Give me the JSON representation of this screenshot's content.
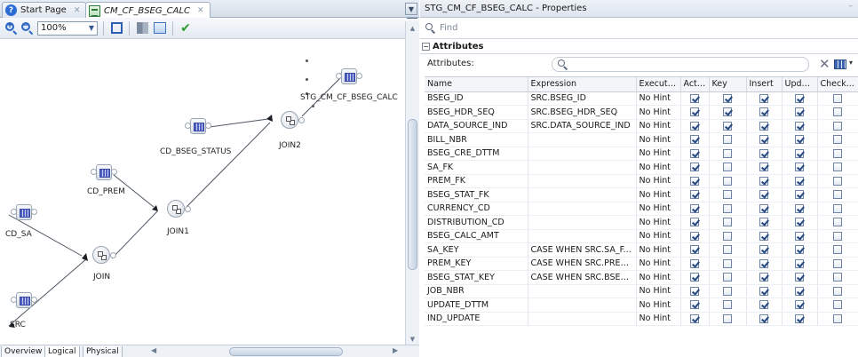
{
  "editor": {
    "tabs": [
      {
        "label": "Start Page",
        "active": false
      },
      {
        "label": "CM_CF_BSEG_CALC",
        "active": true
      }
    ],
    "zoom_value": "100%",
    "nodes": {
      "target": "STG_CM_CF_BSEG_CALC",
      "cd_bseg_status": "CD_BSEG_STATUS",
      "join2": "JOIN2",
      "cd_prem": "CD_PREM",
      "join1": "JOIN1",
      "cd_sa": "CD_SA",
      "join": "JOIN",
      "src": "SRC"
    },
    "bottom_tabs": [
      "Overview",
      "Logical",
      "Physical"
    ]
  },
  "properties": {
    "title": "STG_CM_CF_BSEG_CALC - Properties",
    "find_placeholder": "Find",
    "section_title": "Attributes",
    "attributes_label": "Attributes:",
    "columns": [
      "Name",
      "Expression",
      "Execute ...",
      "Active",
      "Key",
      "Insert",
      "Update",
      "Check..."
    ],
    "rows": [
      {
        "name": "BSEG_ID",
        "expression": "SRC.BSEG_ID",
        "execute": "No Hint",
        "active": true,
        "key": true,
        "insert": true,
        "update": true,
        "check": false
      },
      {
        "name": "BSEG_HDR_SEQ",
        "expression": "SRC.BSEG_HDR_SEQ",
        "execute": "No Hint",
        "active": true,
        "key": true,
        "insert": true,
        "update": true,
        "check": false
      },
      {
        "name": "DATA_SOURCE_IND",
        "expression": "SRC.DATA_SOURCE_IND",
        "execute": "No Hint",
        "active": true,
        "key": true,
        "insert": true,
        "update": true,
        "check": false
      },
      {
        "name": "BILL_NBR",
        "expression": "",
        "execute": "No Hint",
        "active": true,
        "key": false,
        "insert": true,
        "update": true,
        "check": false
      },
      {
        "name": "BSEG_CRE_DTTM",
        "expression": "",
        "execute": "No Hint",
        "active": true,
        "key": false,
        "insert": true,
        "update": true,
        "check": false
      },
      {
        "name": "SA_FK",
        "expression": "",
        "execute": "No Hint",
        "active": true,
        "key": false,
        "insert": true,
        "update": true,
        "check": false
      },
      {
        "name": "PREM_FK",
        "expression": "",
        "execute": "No Hint",
        "active": true,
        "key": false,
        "insert": true,
        "update": true,
        "check": false
      },
      {
        "name": "BSEG_STAT_FK",
        "expression": "",
        "execute": "No Hint",
        "active": true,
        "key": false,
        "insert": true,
        "update": true,
        "check": false
      },
      {
        "name": "CURRENCY_CD",
        "expression": "",
        "execute": "No Hint",
        "active": true,
        "key": false,
        "insert": true,
        "update": true,
        "check": false
      },
      {
        "name": "DISTRIBUTION_CD",
        "expression": "",
        "execute": "No Hint",
        "active": true,
        "key": false,
        "insert": true,
        "update": true,
        "check": false
      },
      {
        "name": "BSEG_CALC_AMT",
        "expression": "",
        "execute": "No Hint",
        "active": true,
        "key": false,
        "insert": true,
        "update": true,
        "check": false
      },
      {
        "name": "SA_KEY",
        "expression": "CASE WHEN SRC.SA_F...",
        "execute": "No Hint",
        "active": true,
        "key": false,
        "insert": true,
        "update": true,
        "check": false
      },
      {
        "name": "PREM_KEY",
        "expression": "CASE WHEN SRC.PREM...",
        "execute": "No Hint",
        "active": true,
        "key": false,
        "insert": true,
        "update": true,
        "check": false
      },
      {
        "name": "BSEG_STAT_KEY",
        "expression": "CASE WHEN SRC.BSEG...",
        "execute": "No Hint",
        "active": true,
        "key": false,
        "insert": true,
        "update": true,
        "check": false
      },
      {
        "name": "JOB_NBR",
        "expression": "",
        "execute": "No Hint",
        "active": true,
        "key": false,
        "insert": true,
        "update": true,
        "check": false
      },
      {
        "name": "UPDATE_DTTM",
        "expression": "",
        "execute": "No Hint",
        "active": true,
        "key": false,
        "insert": true,
        "update": true,
        "check": false
      },
      {
        "name": "IND_UPDATE",
        "expression": "",
        "execute": "No Hint",
        "active": true,
        "key": false,
        "insert": true,
        "update": true,
        "check": false
      }
    ]
  }
}
